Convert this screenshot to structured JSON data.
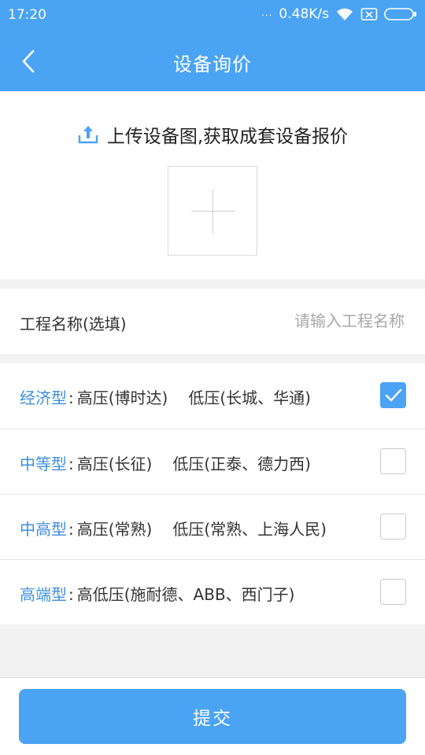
{
  "status_bar": {
    "time": "17:20",
    "dots": "...",
    "network_speed": "0.48K/s",
    "signal_icon": "wifi-icon",
    "sim_icon": "no-sim-icon",
    "battery_icon": "battery-icon"
  },
  "nav": {
    "back_icon": "chevron-left-icon",
    "title": "设备询价"
  },
  "upload": {
    "icon": "upload-icon",
    "heading": "上传设备图,获取成套设备报价",
    "add_icon": "plus-icon"
  },
  "project": {
    "label": "工程名称(选填)",
    "placeholder": "请输入工程名称",
    "value": ""
  },
  "options": [
    {
      "name": "经济型",
      "colon": ":",
      "high_voltage": "高压(博时达)",
      "low_voltage": "低压(长城、华通)",
      "checked": true
    },
    {
      "name": "中等型",
      "colon": ":",
      "high_voltage": "高压(长征)",
      "low_voltage": "低压(正泰、德力西)",
      "checked": false
    },
    {
      "name": "中高型",
      "colon": ":",
      "high_voltage": "高压(常熟)",
      "low_voltage": "低压(常熟、上海人民)",
      "checked": false
    },
    {
      "name": "高端型",
      "colon": ":",
      "high_voltage": "高低压(施耐德、ABB、西门子)",
      "low_voltage": "",
      "checked": false
    }
  ],
  "submit": {
    "label": "提交"
  },
  "colors": {
    "primary": "#4aa3f3",
    "option_name": "#3d8fe0",
    "background": "#f2f2f2"
  }
}
